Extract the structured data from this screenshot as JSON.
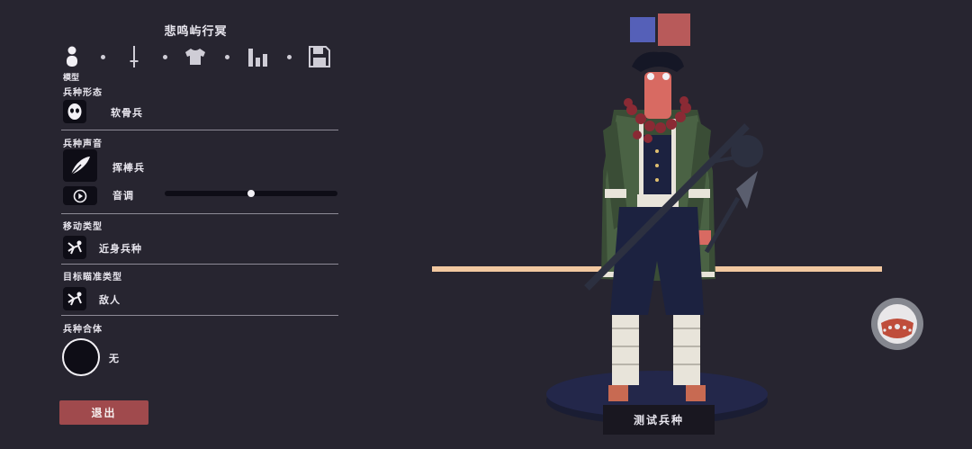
{
  "unit_name": "悲鸣屿行冥",
  "tabs": {
    "active_label": "模型",
    "items": [
      {
        "icon": "person-icon"
      },
      {
        "icon": "sword-icon"
      },
      {
        "icon": "shirt-icon"
      },
      {
        "icon": "bar-chart-icon"
      },
      {
        "icon": "save-icon"
      }
    ]
  },
  "sections": {
    "unit_form": {
      "title": "兵种形态",
      "value": "软骨兵"
    },
    "unit_voice": {
      "title": "兵种声音",
      "value": "挥棒兵",
      "pitch_label": "音调",
      "pitch_level": 0.5
    },
    "movement": {
      "title": "移动类型",
      "value": "近身兵种"
    },
    "targeting": {
      "title": "目标瞄准类型",
      "value": "敌人"
    },
    "combine": {
      "title": "兵种合体",
      "value": "无"
    }
  },
  "buttons": {
    "exit_label": "退出",
    "test_label": "测试兵种"
  },
  "colors": {
    "team_blue": "#5560b8",
    "team_red": "#b85a5a",
    "exit_button": "#a04a4d",
    "background": "#272530"
  }
}
